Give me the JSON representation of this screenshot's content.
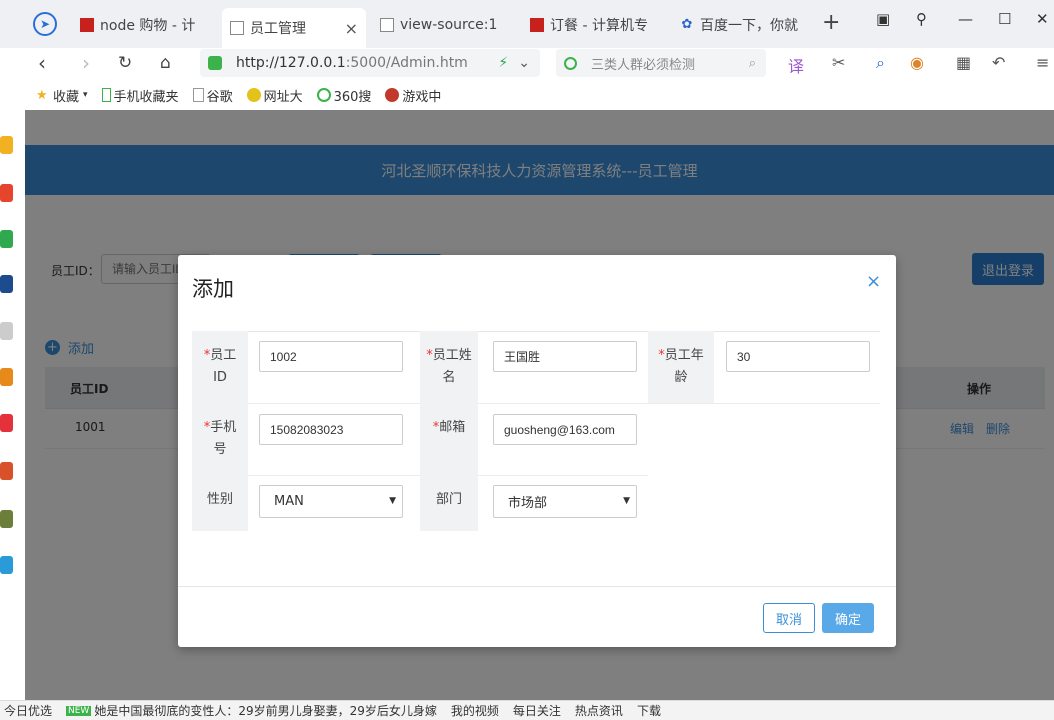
{
  "browser": {
    "tabs": [
      {
        "label": "node 购物 - 计",
        "fav": "red"
      },
      {
        "label": "员工管理",
        "fav": "doc",
        "active": true
      },
      {
        "label": "view-source:1",
        "fav": "doc"
      },
      {
        "label": "订餐 - 计算机专",
        "fav": "red"
      },
      {
        "label": "百度一下，你就",
        "fav": "paw"
      }
    ],
    "tab_close": "×",
    "new_tab": "+",
    "address": {
      "host": "http://127.0.0.1",
      "rest": ":5000/Admin.htm"
    },
    "search_placeholder": "三类人群必须检测",
    "bookmarks": [
      "收藏",
      "手机收藏夹",
      "谷歌",
      "网址大",
      "360搜",
      "游戏中"
    ]
  },
  "page": {
    "header_title": "河北圣顺环保科技人力资源管理系统---员工管理",
    "filter_label": "员工ID：",
    "filter_placeholder": "请输入员工ID",
    "logout": "退出登录",
    "add_link": "添加",
    "table": {
      "headers": [
        "员工ID",
        "操作"
      ],
      "rows": [
        {
          "id": "1001",
          "edit": "编辑",
          "delete": "删除"
        }
      ]
    }
  },
  "dialog": {
    "title": "添加",
    "close": "×",
    "fields": {
      "emp_id": {
        "label1": "员工",
        "label2": "ID",
        "value": "1002"
      },
      "emp_name": {
        "label1": "员工姓",
        "label2": "名",
        "value": "王国胜"
      },
      "emp_age": {
        "label1": "员工年",
        "label2": "龄",
        "value": "30"
      },
      "phone": {
        "label1": "手机",
        "label2": "号",
        "value": "15082083023"
      },
      "email": {
        "label1": "邮箱",
        "value": "guosheng@163.com"
      },
      "gender": {
        "label": "性别",
        "value": "MAN"
      },
      "dept": {
        "label": "部门",
        "value": "市场部"
      }
    },
    "required_mark": "*",
    "cancel": "取消",
    "confirm": "确定"
  },
  "statusbar": {
    "items": [
      "今日优选",
      "NEW",
      "她是中国最彻底的变性人：29岁前男儿身娶妻，29岁后女儿身嫁",
      "我的视频",
      "每日关注",
      "热点资讯",
      "下载"
    ]
  },
  "colors": {
    "header_blue": "#3a8fd8",
    "overlay": "rgba(0,0,0,0.5)",
    "required_red": "#e33"
  }
}
